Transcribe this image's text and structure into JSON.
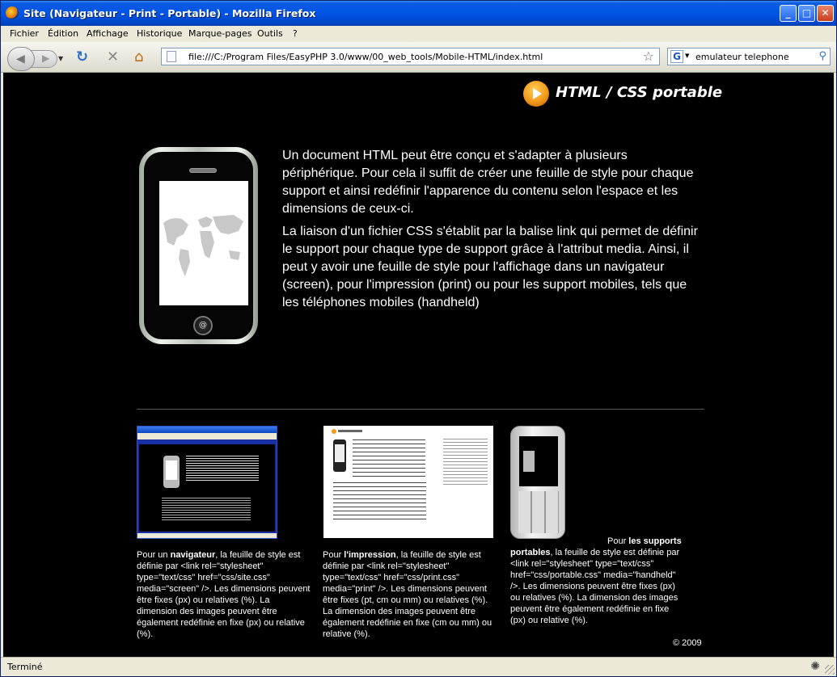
{
  "window": {
    "title": "Site (Navigateur - Print - Portable) - Mozilla Firefox",
    "buttons": {
      "minimize": "_",
      "maximize": "□",
      "close": "✕"
    }
  },
  "menu": [
    "Fichier",
    "Édition",
    "Affichage",
    "Historique",
    "Marque-pages",
    "Outils",
    "?"
  ],
  "nav": {
    "url": "file:///C:/Program Files/EasyPHP 3.0/www/00_web_tools/Mobile-HTML/index.html",
    "search_engine": "G",
    "search_value": "emulateur telephone"
  },
  "page": {
    "logo_text": "HTML / CSS portable",
    "intro_p1": "Un document HTML peut être conçu et s'adapter à plusieurs périphérique. Pour cela il suffit de créer une feuille de style pour chaque support et ainsi redéfinir l'apparence du contenu selon l'espace et les dimensions de ceux-ci.",
    "intro_p2": "La liaison d'un fichier CSS s'établit par la balise link qui permet de définir le support pour chaque type de support grâce à l'attribut media. Ainsi, il peut y avoir une feuille de style pour l'affichage dans un navigateur (screen), pour l'impression (print) ou pour les support mobiles, tels que les téléphones mobiles (handheld)",
    "phone_button": "@",
    "captions": [
      {
        "pre": "Pour un ",
        "bold": "navigateur",
        "post": ", la feuille de style est définie par <link rel=\"stylesheet\" type=\"text/css\" href=\"css/site.css\" media=\"screen\" />. Les dimensions peuvent être fixes (px) ou relatives (%). La dimension des images peuvent être également redéfinie en fixe (px) ou relative (%)."
      },
      {
        "pre": "Pour ",
        "bold": "l'impression",
        "post": ", la feuille de style est définie par <link rel=\"stylesheet\" type=\"text/css\" href=\"css/print.css\" media=\"print\" />. Les dimensions peuvent être fixes (pt, cm ou mm) ou relatives (%). La dimension des images peuvent être également redéfinie en fixe (cm ou mm) ou relative (%)."
      },
      {
        "pre": "Pour ",
        "bold": "les supports portables",
        "post": ", la feuille de style est définie par <link rel=\"stylesheet\" type=\"text/css\" href=\"css/portable.css\" media=\"handheld\" />. Les dimensions peuvent être fixes (px) ou relatives (%). La dimension des images peuvent être également redéfinie en fixe (px) ou relative (%)."
      }
    ],
    "copyright": "© 2009"
  },
  "status": {
    "text": "Terminé"
  },
  "icons": {
    "back": "arrow-left-icon",
    "forward": "arrow-right-icon",
    "reload": "reload-icon",
    "stop": "stop-icon",
    "home": "home-icon",
    "bookmark": "star-icon",
    "search": "magnifier-icon"
  },
  "colors": {
    "titlebar": "#0055e5",
    "page_bg": "#000000",
    "accent": "#f29a1a"
  }
}
